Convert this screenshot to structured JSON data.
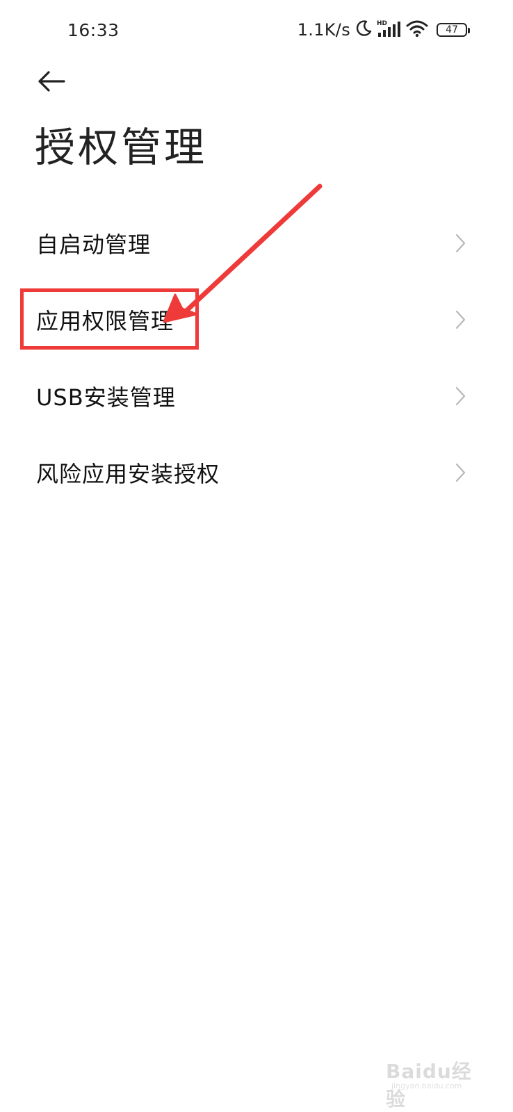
{
  "status_bar": {
    "time": "16:33",
    "net_speed": "1.1K/s",
    "battery_level": "47",
    "icons": [
      "moon-icon",
      "hd-signal-icon",
      "wifi-icon",
      "battery-icon"
    ]
  },
  "header": {
    "back_icon": "arrow-left-icon",
    "title": "授权管理"
  },
  "menu": {
    "items": [
      {
        "label": "自启动管理",
        "icon": "chevron-right-icon"
      },
      {
        "label": "应用权限管理",
        "icon": "chevron-right-icon",
        "highlighted": true
      },
      {
        "label": "USB安装管理",
        "icon": "chevron-right-icon"
      },
      {
        "label": "风险应用安装授权",
        "icon": "chevron-right-icon"
      }
    ]
  },
  "annotation": {
    "color": "#ef3a3a",
    "target": "应用权限管理"
  },
  "watermark": {
    "logo": "Baidu经验",
    "url": "jingyan.baidu.com"
  }
}
